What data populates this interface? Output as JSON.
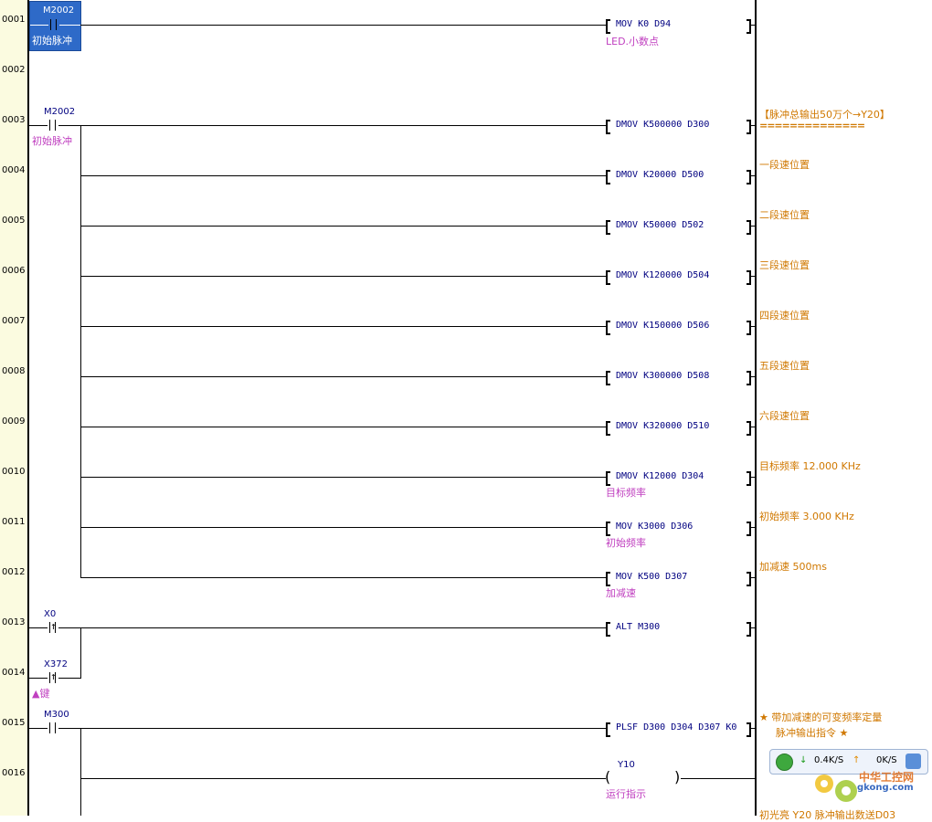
{
  "rungs": [
    {
      "step": "0001",
      "contacts": [
        {
          "label": "M2002",
          "comment": "初始脉冲",
          "type": "NO"
        }
      ],
      "instr": "MOV K0 D94",
      "instr_comment": "LED.小数点",
      "right_comment": ""
    },
    {
      "step": "0002",
      "contacts": [],
      "instr": "",
      "instr_comment": "",
      "right_comment": ""
    },
    {
      "step": "0003",
      "contacts": [
        {
          "label": "M2002",
          "comment": "初始脉冲",
          "type": "NO"
        }
      ],
      "instr": "DMOV K500000 D300",
      "instr_comment": "",
      "right_comment": "【脉冲总输出50万个→Y20】"
    },
    {
      "step": "0004",
      "instr": "DMOV K20000 D500",
      "instr_comment": "",
      "right_comment": "一段速位置"
    },
    {
      "step": "0005",
      "instr": "DMOV K50000 D502",
      "instr_comment": "",
      "right_comment": "二段速位置"
    },
    {
      "step": "0006",
      "instr": "DMOV K120000 D504",
      "instr_comment": "",
      "right_comment": "三段速位置"
    },
    {
      "step": "0007",
      "instr": "DMOV K150000 D506",
      "instr_comment": "",
      "right_comment": "四段速位置"
    },
    {
      "step": "0008",
      "instr": "DMOV K300000 D508",
      "instr_comment": "",
      "right_comment": "五段速位置"
    },
    {
      "step": "0009",
      "instr": "DMOV K320000 D510",
      "instr_comment": "",
      "right_comment": "六段速位置"
    },
    {
      "step": "0010",
      "instr": "DMOV K12000 D304",
      "instr_comment": "目标频率",
      "right_comment": "目标频率 12.000 KHz"
    },
    {
      "step": "0011",
      "instr": "MOV K3000 D306",
      "instr_comment": "初始频率",
      "right_comment": "初始频率 3.000 KHz"
    },
    {
      "step": "0012",
      "instr": "MOV K500 D307",
      "instr_comment": "加减速",
      "right_comment": "加减速 500ms"
    },
    {
      "step": "0013",
      "contacts": [
        {
          "label": "X0",
          "comment": "",
          "type": "rising"
        }
      ],
      "instr": "ALT M300",
      "instr_comment": "",
      "right_comment": ""
    },
    {
      "step": "0014",
      "contacts": [
        {
          "label": "X372",
          "comment": "▲键",
          "type": "rising"
        }
      ],
      "instr": "",
      "instr_comment": "",
      "right_comment": ""
    },
    {
      "step": "0015",
      "contacts": [
        {
          "label": "M300",
          "comment": "",
          "type": "NO"
        }
      ],
      "instr": "PLSF D300 D304 D307 K0",
      "instr_comment": "",
      "right_comment": "★ 带加减速的可变频率定量",
      "right_comment2": "脉冲输出指令 ★"
    },
    {
      "step": "0016",
      "coil": {
        "label": "Y10",
        "comment": "运行指示"
      },
      "right_comment": ""
    }
  ],
  "equals_line": "==============",
  "bottom_comment": "初光亮 Y20 脉冲输出数送D03",
  "network_widget": {
    "down_rate": "0.4K/S",
    "up_rate": "0K/S"
  },
  "watermark": {
    "line1": "中华工控网",
    "line2": "gkong.com"
  },
  "colors": {
    "gutter": "#fbfbe0",
    "selection": "#2e6ac8",
    "instr": "#000080",
    "comment": "#c040c0",
    "right_comment": "#d07800"
  }
}
